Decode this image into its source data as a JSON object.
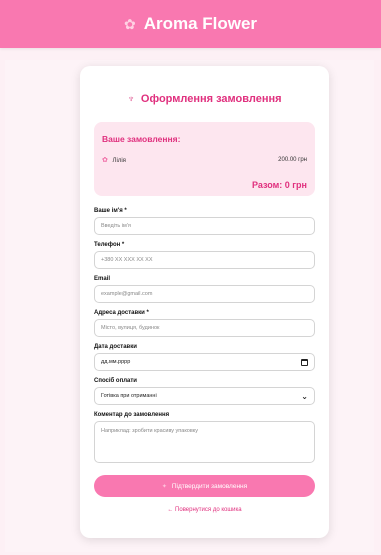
{
  "header": {
    "logo_icon": "flower-icon",
    "title": "Aroma Flower"
  },
  "card": {
    "title": "Оформлення замовлення",
    "title_icon": "tulip-icon"
  },
  "summary": {
    "title": "Ваше замовлення:",
    "items": [
      {
        "name": "Лілія",
        "price": "200.00 грн"
      }
    ],
    "total": "Разом: 0 грн"
  },
  "form": {
    "name": {
      "label": "Ваше ім'я *",
      "placeholder": "Введіть ім'я"
    },
    "phone": {
      "label": "Телефон *",
      "placeholder": "+380 XX XXX XX XX"
    },
    "email": {
      "label": "Email",
      "placeholder": "example@gmail.com"
    },
    "address": {
      "label": "Адреса доставки *",
      "placeholder": "Місто, вулиця, будинок"
    },
    "date": {
      "label": "Дата доставки",
      "value": "дд.мм.рррр"
    },
    "payment": {
      "label": "Спосіб оплати",
      "value": "Готівка при отриманні"
    },
    "comment": {
      "label": "Коментар до замовлення",
      "placeholder": "Наприклад: зробити красиву упаковку"
    }
  },
  "actions": {
    "submit_label": "Підтвердити замовлення",
    "back_label": "← Повернутися до кошика"
  },
  "colors": {
    "accent": "#f978b0",
    "brand_text": "#e0307e",
    "summary_bg": "#fde6ef"
  }
}
